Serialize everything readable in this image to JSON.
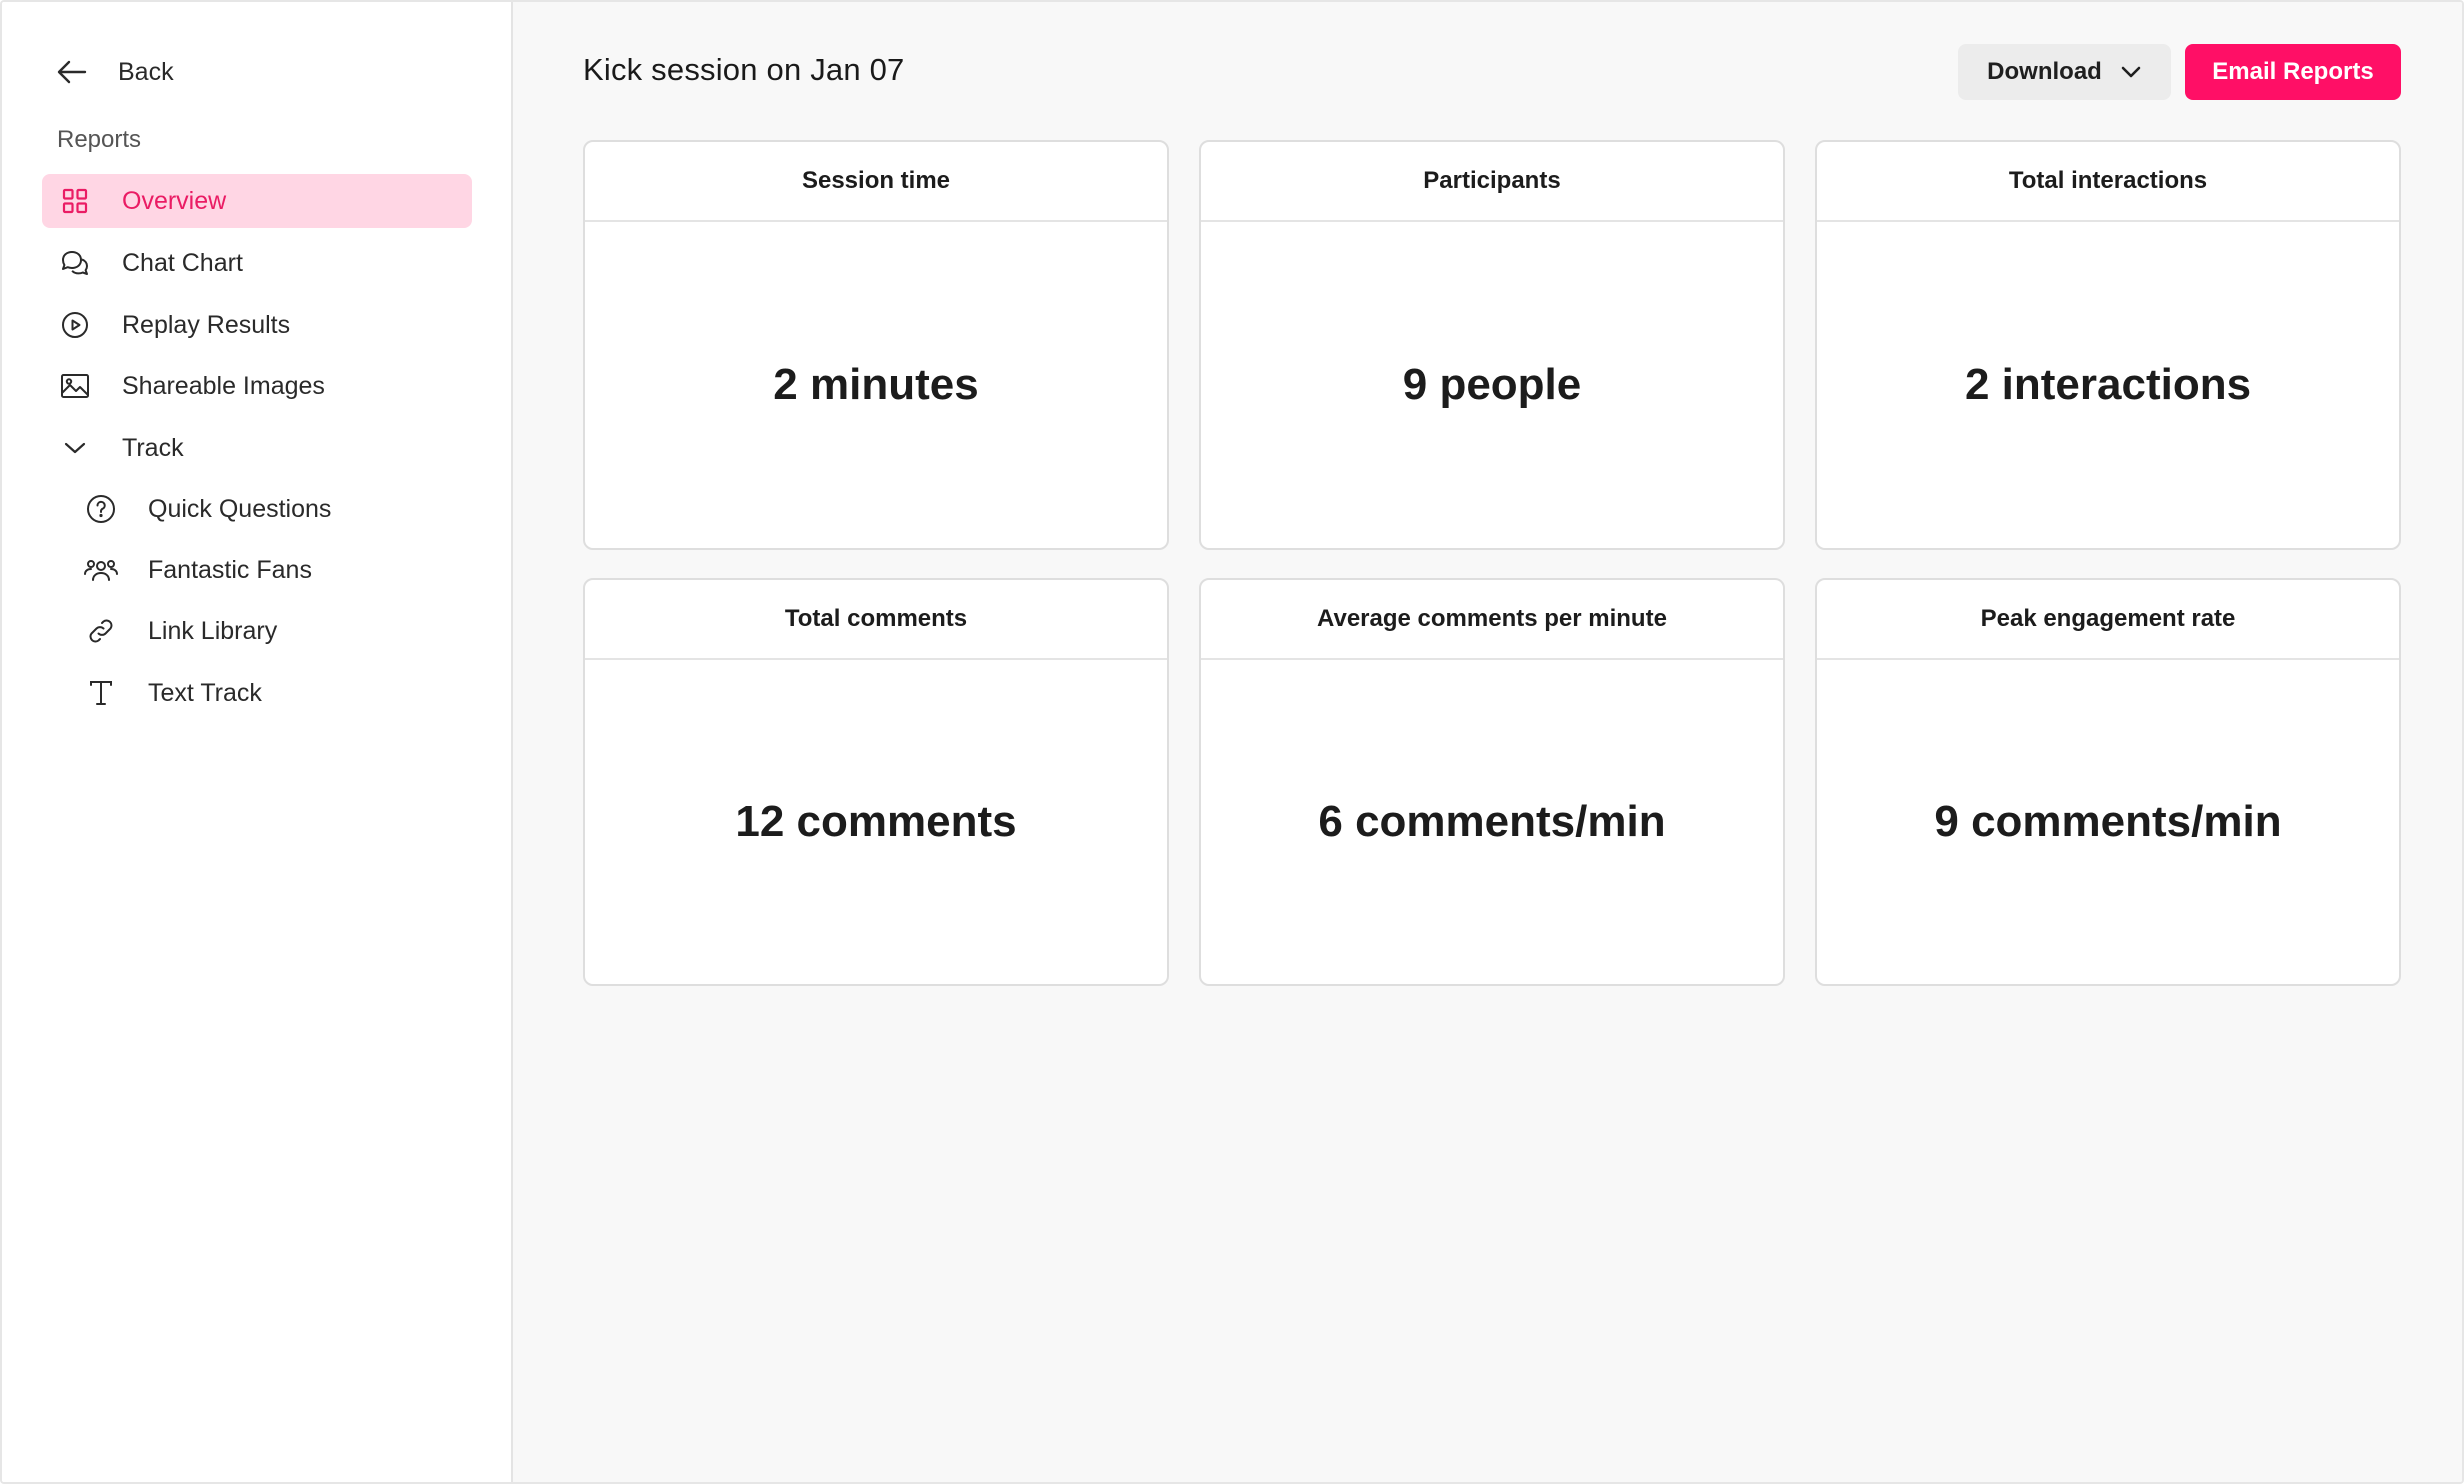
{
  "sidebar": {
    "back_label": "Back",
    "section_label": "Reports",
    "items": [
      {
        "label": "Overview",
        "icon": "grid-icon",
        "active": true
      },
      {
        "label": "Chat Chart",
        "icon": "chat-icon"
      },
      {
        "label": "Replay Results",
        "icon": "play-circle-icon"
      },
      {
        "label": "Shareable Images",
        "icon": "image-icon"
      },
      {
        "label": "Track",
        "icon": "chevron-down-icon"
      },
      {
        "label": "Quick Questions",
        "icon": "question-circle-icon"
      },
      {
        "label": "Fantastic Fans",
        "icon": "users-icon"
      },
      {
        "label": "Link Library",
        "icon": "link-icon"
      },
      {
        "label": "Text Track",
        "icon": "text-icon"
      }
    ]
  },
  "header": {
    "title": "Kick session on Jan 07",
    "download_label": "Download",
    "email_label": "Email Reports"
  },
  "cards": [
    {
      "title": "Session time",
      "value": "2 minutes"
    },
    {
      "title": "Participants",
      "value": "9 people"
    },
    {
      "title": "Total interactions",
      "value": "2 interactions"
    },
    {
      "title": "Total comments",
      "value": "12 comments"
    },
    {
      "title": "Average comments per minute",
      "value": "6 comments/min"
    },
    {
      "title": "Peak engagement rate",
      "value": "9 comments/min"
    }
  ],
  "colors": {
    "accent": "#ff0f66",
    "active_bg": "#ffd6e4",
    "active_text": "#ea1c64"
  }
}
